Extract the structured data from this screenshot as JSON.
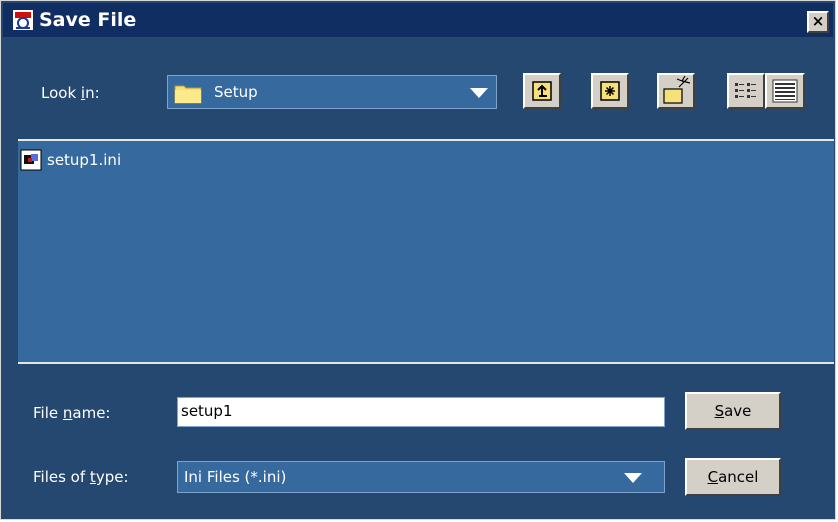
{
  "window": {
    "title": "Save File",
    "close_label": "×"
  },
  "look_in": {
    "label_pre": "Look ",
    "label_accel": "i",
    "label_post": "n:",
    "value": "Setup",
    "icon": "folder-icon"
  },
  "toolbar": {
    "buttons": [
      {
        "name": "up-one-level",
        "icon": "folder-up-icon"
      },
      {
        "name": "home",
        "icon": "home-folder-icon"
      },
      {
        "name": "new-folder",
        "icon": "new-folder-icon"
      },
      {
        "name": "list-view",
        "icon": "list-view-icon"
      },
      {
        "name": "details-view",
        "icon": "details-view-icon"
      }
    ]
  },
  "files": [
    {
      "name": "setup1.ini",
      "icon": "ini-file-icon"
    }
  ],
  "file_name": {
    "label_pre": "File ",
    "label_accel": "n",
    "label_post": "ame:",
    "value": "setup1"
  },
  "file_type": {
    "label_pre": "Files of ",
    "label_accel": "t",
    "label_post": "ype:",
    "value": "Ini Files (*.ini)"
  },
  "buttons": {
    "save_accel": "S",
    "save_rest": "ave",
    "cancel_accel": "C",
    "cancel_rest": "ancel"
  },
  "colors": {
    "title_bar": "#112e63",
    "dialog_bg": "#24486f",
    "list_bg": "#36699e",
    "button_face": "#d4d0c8"
  }
}
